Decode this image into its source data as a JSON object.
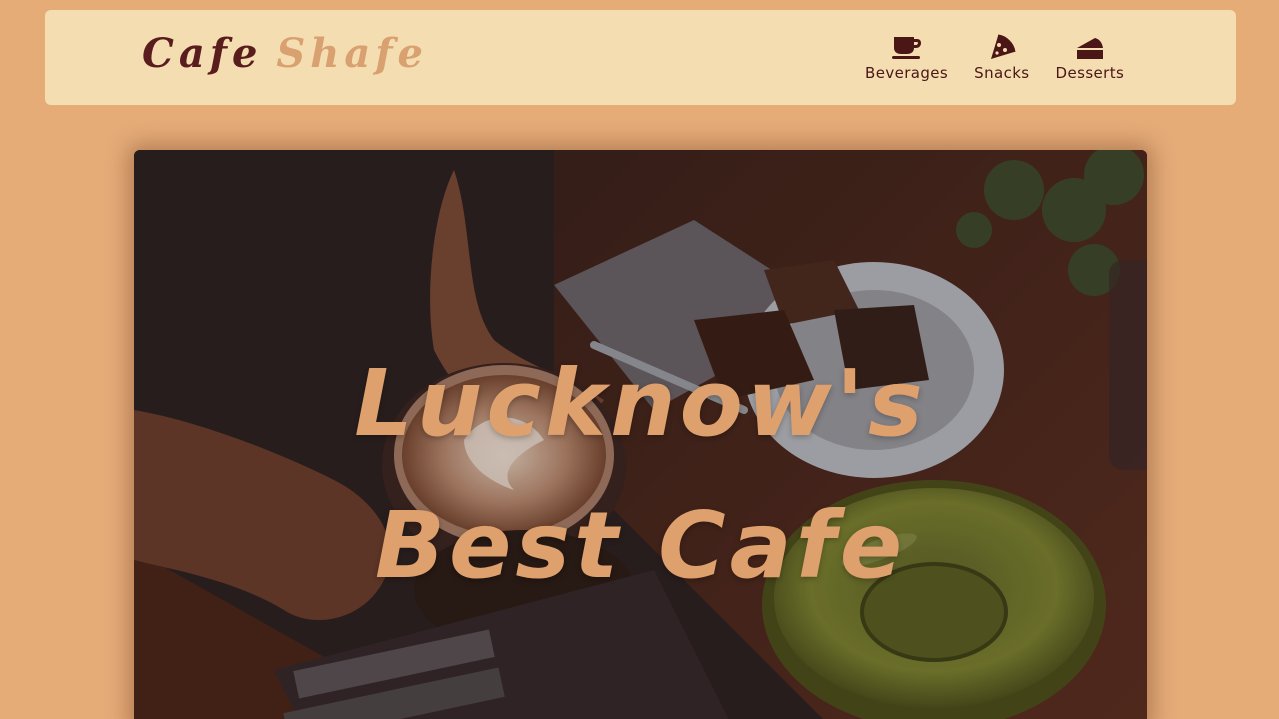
{
  "logo": {
    "part1": "Cafe",
    "part2": "Shafe"
  },
  "nav": {
    "items": [
      {
        "label": "Beverages",
        "icon": "coffee-cup-icon"
      },
      {
        "label": "Snacks",
        "icon": "pizza-slice-icon"
      },
      {
        "label": "Desserts",
        "icon": "cake-slice-icon"
      }
    ]
  },
  "hero": {
    "title_line1": "Lucknow's",
    "title_line2": "Best Cafe"
  },
  "colors": {
    "page_background": "#e5ac78",
    "navbar_background": "#f5ddb2",
    "brand_dark": "#5a1d1d",
    "brand_light": "#d9a070",
    "hero_text": "#dea06d"
  }
}
